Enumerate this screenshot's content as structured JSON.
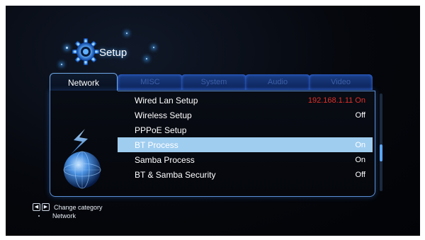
{
  "app": {
    "title": "Setup"
  },
  "tabs": [
    {
      "label": "Network",
      "active": true
    },
    {
      "label": "MISC",
      "active": false
    },
    {
      "label": "System",
      "active": false
    },
    {
      "label": "Audio",
      "active": false
    },
    {
      "label": "Video",
      "active": false
    }
  ],
  "menu": [
    {
      "label": "Wired Lan Setup",
      "value": "192.168.1.11 On",
      "value_color": "#e0302a"
    },
    {
      "label": "Wireless Setup",
      "value": "Off"
    },
    {
      "label": "PPPoE Setup",
      "value": ""
    },
    {
      "label": "BT Process",
      "value": "On",
      "selected": true
    },
    {
      "label": "Samba Process",
      "value": "On"
    },
    {
      "label": "BT & Samba Security",
      "value": "Off"
    }
  ],
  "footer": {
    "hint": "Change category",
    "current": "Network"
  },
  "icons": {
    "header": "gear-icon",
    "left_art": "globe-icon",
    "prev": "left-arrow-icon",
    "next": "right-arrow-icon"
  },
  "colors": {
    "accent": "#5b8fd6",
    "selection": "#9fcdf0",
    "warning": "#e0302a"
  }
}
